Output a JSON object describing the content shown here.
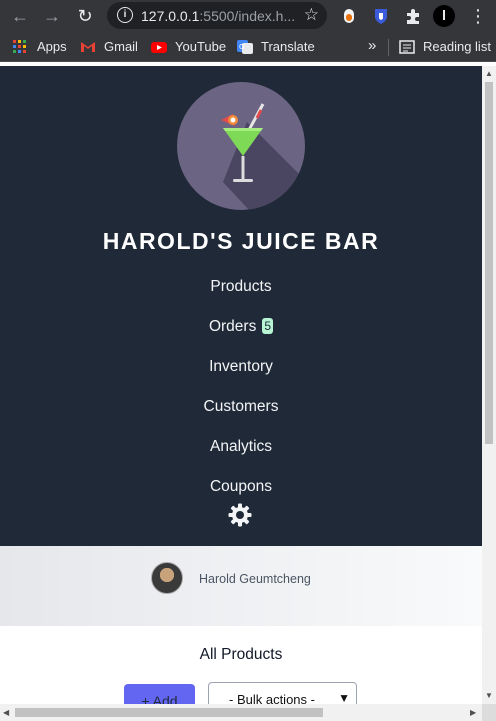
{
  "browser": {
    "url_host": "127.0.0.1",
    "url_rest": ":5500/index.h...",
    "bookmarks": {
      "apps": "Apps",
      "gmail": "Gmail",
      "youtube": "YouTube",
      "translate": "Translate",
      "more": "»",
      "reading_list": "Reading list"
    }
  },
  "sidebar": {
    "brand": "HAROLD'S JUICE BAR",
    "nav": {
      "products": "Products",
      "orders": "Orders",
      "orders_badge": "5",
      "inventory": "Inventory",
      "customers": "Customers",
      "analytics": "Analytics",
      "coupons": "Coupons"
    }
  },
  "profile": {
    "name": "Harold Geumtcheng"
  },
  "main": {
    "title": "All Products",
    "add_label": "+ Add",
    "bulk_label": "- Bulk actions -"
  },
  "colors": {
    "sidebar_bg": "#1f2937",
    "logo_bg": "#6b6483",
    "accent": "#6366f1",
    "badge_bg": "#b7f5d4"
  },
  "icons": [
    "back-icon",
    "forward-icon",
    "reload-icon",
    "info-icon",
    "star-icon",
    "extension-icon",
    "puzzle-icon",
    "menu-icon",
    "cocktail-icon",
    "gear-icon"
  ]
}
